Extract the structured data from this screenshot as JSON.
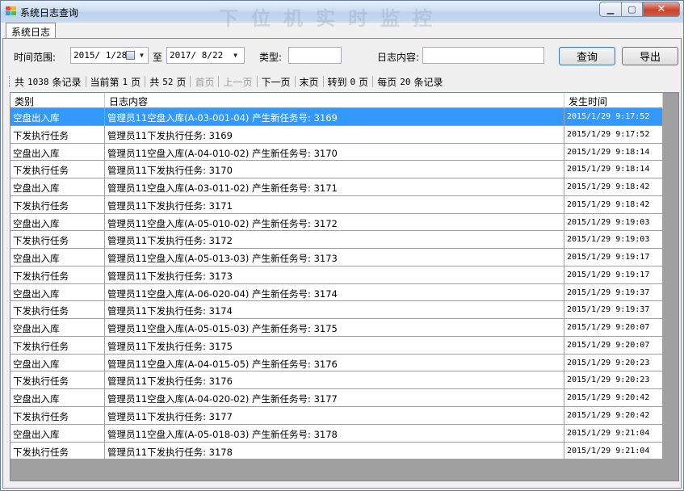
{
  "window": {
    "title": "系统日志查询",
    "watermark": "下位机实时监控",
    "minimize_glyph": "▁",
    "maximize_glyph": "▢",
    "close_glyph": "✕"
  },
  "tabs": [
    {
      "label": "系统日志",
      "active": true
    }
  ],
  "filters": {
    "time_range_label": "时间范围:",
    "start_date": "2015/ 1/28",
    "to_label": "至",
    "end_date": "2017/ 8/22",
    "type_label": "类型:",
    "type_value": "",
    "content_label": "日志内容:",
    "content_value": "",
    "query_button": "查询",
    "export_button": "导出"
  },
  "pager": {
    "total_prefix": "共",
    "total_records": "1038",
    "total_suffix": "条记录",
    "current_prefix": "当前第",
    "current_page": "1",
    "current_suffix": "页",
    "pages_prefix": "共",
    "total_pages": "52",
    "pages_suffix": "页",
    "first": "首页",
    "prev": "上一页",
    "next": "下一页",
    "last": "末页",
    "goto_prefix": "转到",
    "goto_page": "0",
    "goto_suffix": "页",
    "per_page_prefix": "每页",
    "per_page": "20",
    "per_page_suffix": "条记录"
  },
  "table": {
    "columns": [
      "类别",
      "日志内容",
      "发生时间"
    ],
    "rows": [
      [
        "空盘出入库",
        "管理员11空盘入库(A-03-001-04) 产生新任务号: 3169",
        "2015/1/29 9:17:52"
      ],
      [
        "下发执行任务",
        "管理员11下发执行任务: 3169",
        "2015/1/29 9:17:52"
      ],
      [
        "空盘出入库",
        "管理员11空盘入库(A-04-010-02) 产生新任务号: 3170",
        "2015/1/29 9:18:14"
      ],
      [
        "下发执行任务",
        "管理员11下发执行任务: 3170",
        "2015/1/29 9:18:14"
      ],
      [
        "空盘出入库",
        "管理员11空盘入库(A-03-011-02) 产生新任务号: 3171",
        "2015/1/29 9:18:42"
      ],
      [
        "下发执行任务",
        "管理员11下发执行任务: 3171",
        "2015/1/29 9:18:42"
      ],
      [
        "空盘出入库",
        "管理员11空盘入库(A-05-010-02) 产生新任务号: 3172",
        "2015/1/29 9:19:03"
      ],
      [
        "下发执行任务",
        "管理员11下发执行任务: 3172",
        "2015/1/29 9:19:03"
      ],
      [
        "空盘出入库",
        "管理员11空盘入库(A-05-013-03) 产生新任务号: 3173",
        "2015/1/29 9:19:17"
      ],
      [
        "下发执行任务",
        "管理员11下发执行任务: 3173",
        "2015/1/29 9:19:17"
      ],
      [
        "空盘出入库",
        "管理员11空盘入库(A-06-020-04) 产生新任务号: 3174",
        "2015/1/29 9:19:37"
      ],
      [
        "下发执行任务",
        "管理员11下发执行任务: 3174",
        "2015/1/29 9:19:37"
      ],
      [
        "空盘出入库",
        "管理员11空盘入库(A-05-015-03) 产生新任务号: 3175",
        "2015/1/29 9:20:07"
      ],
      [
        "下发执行任务",
        "管理员11下发执行任务: 3175",
        "2015/1/29 9:20:07"
      ],
      [
        "空盘出入库",
        "管理员11空盘入库(A-04-015-05) 产生新任务号: 3176",
        "2015/1/29 9:20:23"
      ],
      [
        "下发执行任务",
        "管理员11下发执行任务: 3176",
        "2015/1/29 9:20:23"
      ],
      [
        "空盘出入库",
        "管理员11空盘入库(A-04-020-02) 产生新任务号: 3177",
        "2015/1/29 9:20:42"
      ],
      [
        "下发执行任务",
        "管理员11下发执行任务: 3177",
        "2015/1/29 9:20:42"
      ],
      [
        "空盘出入库",
        "管理员11空盘入库(A-05-018-03) 产生新任务号: 3178",
        "2015/1/29 9:21:04"
      ],
      [
        "下发执行任务",
        "管理员11下发执行任务: 3178",
        "2015/1/29 9:21:04"
      ]
    ],
    "selected_row": 0
  },
  "colors": {
    "selection": "#3399ff",
    "grid_background": "#a0a0a0",
    "app_icon": [
      "#e24b3b",
      "#f2b230",
      "#3c9be0",
      "#59b84a"
    ]
  },
  "icons": [
    "app-icon",
    "calendar-icon",
    "dropdown-arrow-icon",
    "minimize-icon",
    "maximize-icon",
    "close-icon"
  ]
}
